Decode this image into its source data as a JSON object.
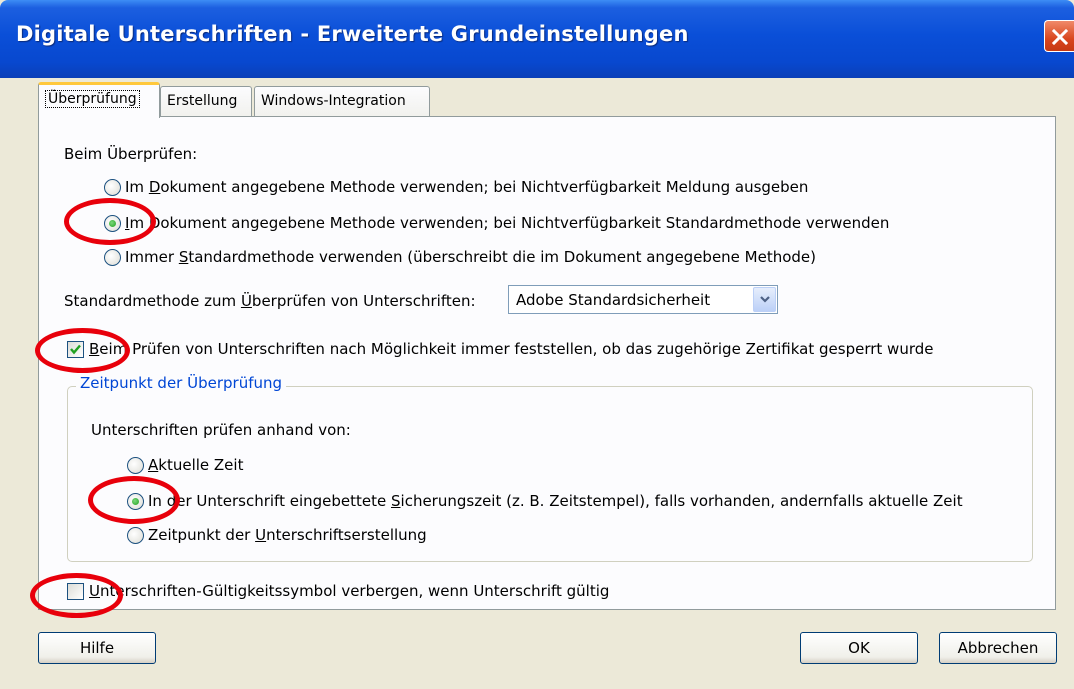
{
  "window": {
    "title": "Digitale Unterschriften - Erweiterte Grundeinstellungen"
  },
  "tabs": [
    {
      "label": "Überprüfung",
      "selected": true
    },
    {
      "label": "Erstellung",
      "selected": false
    },
    {
      "label": "Windows-Integration",
      "selected": false
    }
  ],
  "verify": {
    "heading": "Beim Überprüfen:",
    "options": [
      {
        "prefix": "Im ",
        "key": "D",
        "rest": "okument angegebene Methode verwenden; bei Nichtverfügbarkeit Meldung ausgeben",
        "selected": false
      },
      {
        "prefix": "",
        "key": "I",
        "rest": "m Dokument angegebene Methode verwenden; bei Nichtverfügbarkeit Standardmethode verwenden",
        "selected": true
      },
      {
        "prefix": "Immer ",
        "key": "S",
        "rest": "tandardmethode verwenden (überschreibt die im Dokument angegebene Methode)",
        "selected": false
      }
    ],
    "default_method_label_pre": "Standardmethode zum ",
    "default_method_label_key": "Ü",
    "default_method_label_post": "berprüfen von Unterschriften:",
    "default_method_value": "Adobe Standardsicherheit",
    "revocation_check_key": "B",
    "revocation_check_rest": "eim Prüfen von Unterschriften nach Möglichkeit immer feststellen, ob das zugehörige Zertifikat gesperrt wurde",
    "revocation_checked": true
  },
  "time_group": {
    "legend": "Zeitpunkt der Überprüfung",
    "heading": "Unterschriften prüfen anhand von:",
    "options": [
      {
        "pre": "",
        "key": "A",
        "rest": "ktuelle Zeit",
        "selected": false
      },
      {
        "pre": "In der Unterschrift eingebettete ",
        "key": "S",
        "rest": "icherungszeit (z. B. Zeitstempel), falls vorhanden, andernfalls aktuelle Zeit",
        "selected": true
      },
      {
        "pre": "Zeitpunkt der ",
        "key": "U",
        "rest": "nterschriftserstellung",
        "selected": false
      }
    ]
  },
  "hide_symbol": {
    "key": "U",
    "rest": "nterschriften-Gültigkeitssymbol verbergen, wenn Unterschrift gültig",
    "checked": false
  },
  "buttons": {
    "help": "Hilfe",
    "ok": "OK",
    "cancel": "Abbrechen"
  },
  "colors": {
    "titlebar": "#0a4fd8",
    "annotation": "#e8000b",
    "group_legend": "#0046d5"
  }
}
